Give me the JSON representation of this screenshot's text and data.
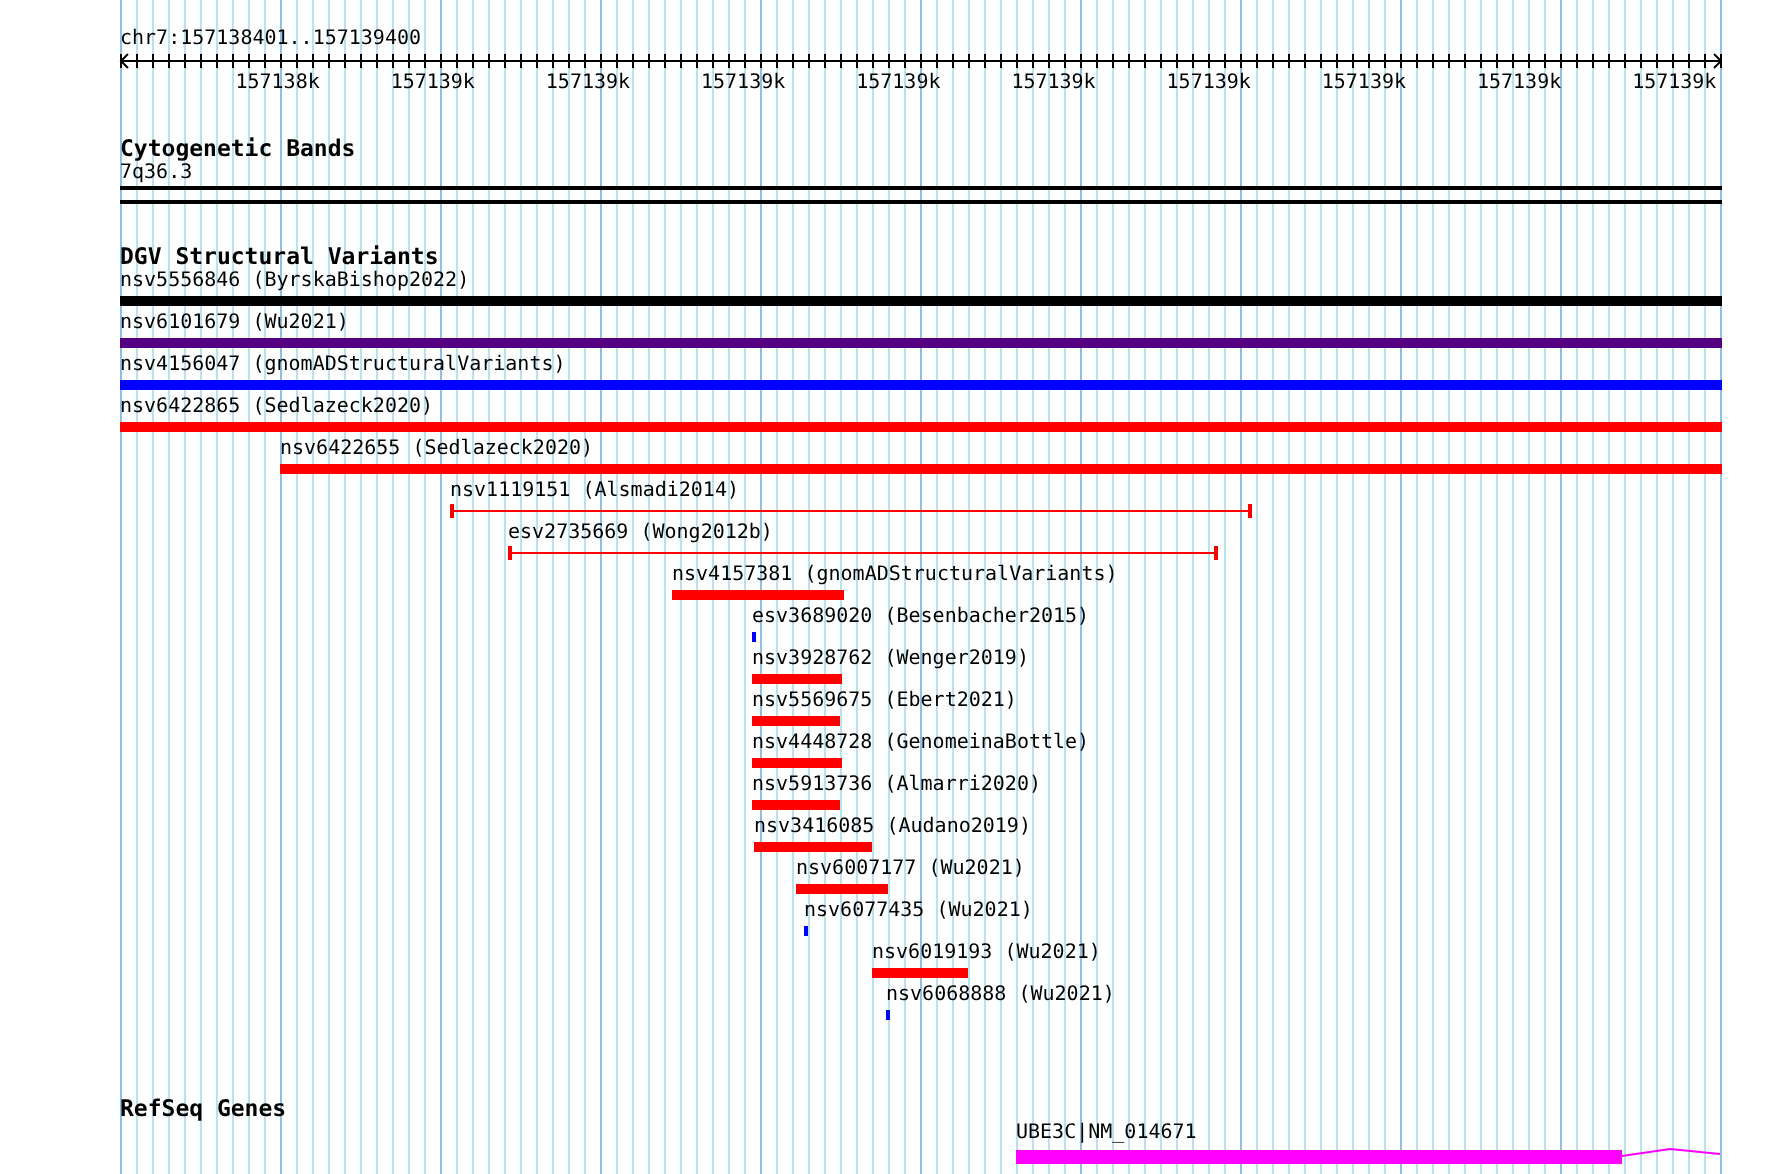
{
  "ruler": {
    "location": "chr7:157138401..157139400",
    "ticks": [
      "157138k",
      "157139k",
      "157139k",
      "157139k",
      "157139k",
      "157139k",
      "157139k",
      "157139k",
      "157139k",
      "157139k"
    ]
  },
  "tracks": [
    {
      "kind": "cytoband",
      "title": "Cytogenetic Bands",
      "band": "7q36.3"
    },
    {
      "kind": "variants",
      "title": "DGV Structural Variants",
      "features": [
        {
          "label": "nsv5556846 (ByrskaBishop2022)",
          "kind": "bar",
          "color": "#000000"
        },
        {
          "label": "nsv6101679 (Wu2021)",
          "kind": "bar",
          "color": "#550080"
        },
        {
          "label": "nsv4156047 (gnomADStructuralVariants)",
          "kind": "bar",
          "color": "#0000ff"
        },
        {
          "label": "nsv6422865 (Sedlazeck2020)",
          "kind": "bar",
          "color": "#ff0000"
        },
        {
          "label": "nsv6422655 (Sedlazeck2020)",
          "kind": "bar",
          "color": "#ff0000"
        },
        {
          "label": "nsv1119151 (Alsmadi2014)",
          "kind": "span",
          "color": "#ff0000"
        },
        {
          "label": "esv2735669 (Wong2012b)",
          "kind": "span",
          "color": "#ff0000"
        },
        {
          "label": "nsv4157381 (gnomADStructuralVariants)",
          "kind": "bar",
          "color": "#ff0000"
        },
        {
          "label": "esv3689020 (Besenbacher2015)",
          "kind": "tick",
          "color": "#0000ff"
        },
        {
          "label": "nsv3928762 (Wenger2019)",
          "kind": "bar",
          "color": "#ff0000"
        },
        {
          "label": "nsv5569675 (Ebert2021)",
          "kind": "bar",
          "color": "#ff0000"
        },
        {
          "label": "nsv4448728 (GenomeinaBottle)",
          "kind": "bar",
          "color": "#ff0000"
        },
        {
          "label": "nsv5913736 (Almarri2020)",
          "kind": "bar",
          "color": "#ff0000"
        },
        {
          "label": "nsv3416085 (Audano2019)",
          "kind": "bar",
          "color": "#ff0000"
        },
        {
          "label": "nsv6007177 (Wu2021)",
          "kind": "bar",
          "color": "#ff0000"
        },
        {
          "label": "nsv6077435 (Wu2021)",
          "kind": "tick",
          "color": "#0000ff"
        },
        {
          "label": "nsv6019193 (Wu2021)",
          "kind": "bar",
          "color": "#ff0000"
        },
        {
          "label": "nsv6068888 (Wu2021)",
          "kind": "tick",
          "color": "#0000ff"
        }
      ]
    },
    {
      "kind": "genes",
      "title": "RefSeq Genes",
      "genes": [
        {
          "label": "UBE3C|NM_014671"
        }
      ]
    }
  ]
}
